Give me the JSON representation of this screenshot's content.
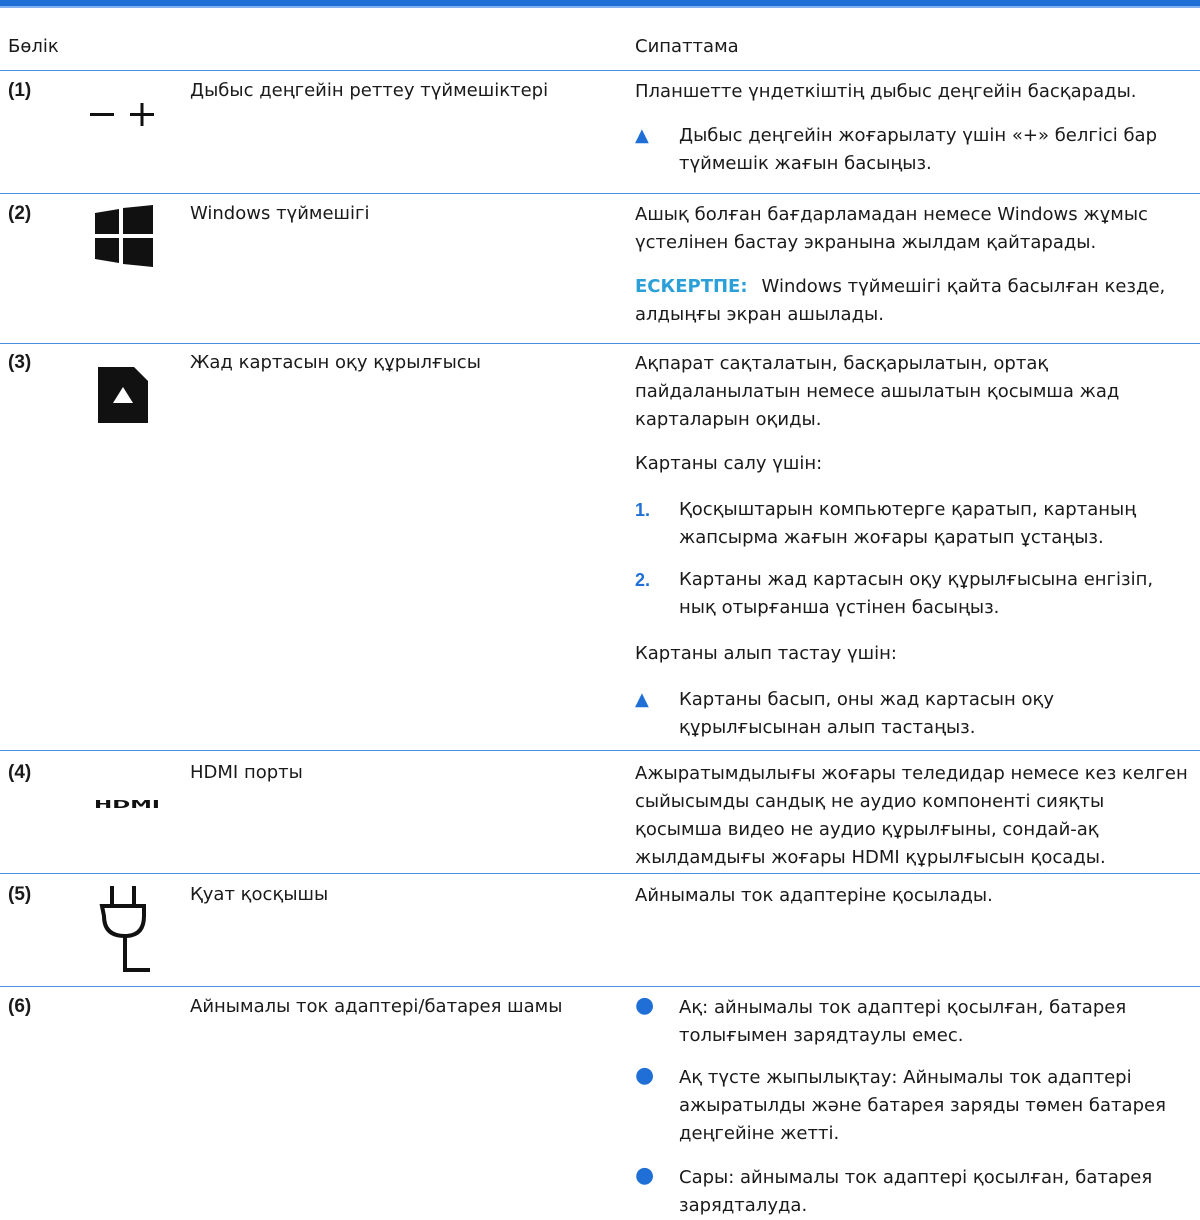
{
  "header": {
    "component": "Бөлік",
    "description": "Сипаттама"
  },
  "rows": [
    {
      "number": "(1)",
      "name": "Дыбыс деңгейін реттеу түймешіктері",
      "icon": "volume-minus-plus-icon",
      "desc": "Планшетте үндеткіштің дыбыс деңгейін басқарады.",
      "tip": "Дыбыс деңгейін жоғарылату үшін «+» белгісі бар түймешік жағын басыңыз."
    },
    {
      "number": "(2)",
      "name": "Windows түймешігі",
      "icon": "windows-logo-icon",
      "desc": "Ашық болған бағдарламадан немесе Windows жұмыс үстелінен бастау экранына жылдам қайтарады.",
      "note_label": "ЕСКЕРТПЕ:",
      "note_text": "Windows түймешігі қайта басылған кезде, алдыңғы экран ашылады."
    },
    {
      "number": "(3)",
      "name": "Жад картасын оқу құрылғысы",
      "icon": "memory-card-icon",
      "desc": "Ақпарат сақталатын, басқарылатын, ортақ пайдаланылатын немесе ашылатын қосымша жад карталарын оқиды.",
      "insert_title": "Картаны салу үшін:",
      "steps": [
        "Қосқыштарын компьютерге қаратып, картаның жапсырма жағын жоғары қаратып ұстаңыз.",
        "Картаны жад картасын оқу құрылғысына енгізіп, нық отырғанша үстінен басыңыз."
      ],
      "remove_title": "Картаны алып тастау үшін:",
      "remove_tip": "Картаны басып, оны жад картасын оқу құрылғысынан алып тастаңыз."
    },
    {
      "number": "(4)",
      "name": "HDMI порты",
      "icon": "hdmi-logo-icon",
      "icon_text": "HDMI",
      "desc": "Ажыратымдылығы жоғары теледидар немесе кез келген сыйысымды сандық не аудио компоненті сияқты қосымша видео не аудио құрылғыны, сондай-ақ жылдамдығы жоғары HDMI құрылғысын қосады."
    },
    {
      "number": "(5)",
      "name": "Қуат қосқышы",
      "icon": "power-plug-icon",
      "desc": "Айнымалы ток адаптеріне қосылады."
    },
    {
      "number": "(6)",
      "name": "Айнымалы ток адаптері/батарея шамы",
      "bullets": [
        "Ақ: айнымалы ток адаптері қосылған, батарея толығымен зарядтаулы емес.",
        "Ақ түсте жыпылықтау: Айнымалы ток адаптері ажыратылды және батарея заряды төмен батарея деңгейіне жетті.",
        "Сары: айнымалы ток адаптері қосылған, батарея зарядталуда."
      ]
    }
  ],
  "colors": {
    "accent": "#1f6fd6",
    "rule": "#4a90e2",
    "note": "#2a9fd8"
  },
  "markers": {
    "triangle": "▲",
    "bullet": "●",
    "step1": "1.",
    "step2": "2."
  }
}
